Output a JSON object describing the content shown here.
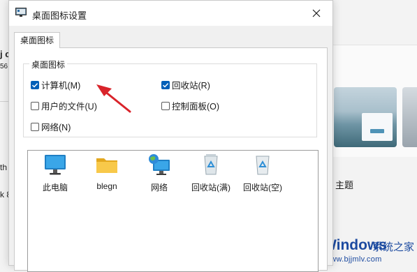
{
  "dialog": {
    "title": "桌面图标设置",
    "tab_label": "桌面图标",
    "group_label": "桌面图标",
    "checkboxes": [
      {
        "label": "计算机(M)",
        "checked": true
      },
      {
        "label": "回收站(R)",
        "checked": true
      },
      {
        "label": "用户的文件(U)",
        "checked": false
      },
      {
        "label": "控制面板(O)",
        "checked": false
      },
      {
        "label": "网络(N)",
        "checked": false
      }
    ],
    "icons": [
      {
        "label": "此电脑",
        "icon": "monitor-icon"
      },
      {
        "label": "blegn",
        "icon": "folder-icon"
      },
      {
        "label": "网络",
        "icon": "network-icon"
      },
      {
        "label": "回收站(满)",
        "icon": "recycle-bin-full-icon"
      },
      {
        "label": "回收站(空)",
        "icon": "recycle-bin-empty-icon"
      }
    ]
  },
  "background": {
    "left_fragments": [
      "j c",
      "56",
      "th",
      "k 8"
    ],
    "theme_label": "主题"
  },
  "watermark": {
    "brand": "Windows",
    "chinese": "系统之家",
    "url": "www.bjjmlv.com"
  },
  "colors": {
    "accent": "#005fb8",
    "arrow": "#d9232a",
    "watermark": "#1d4ba0"
  }
}
